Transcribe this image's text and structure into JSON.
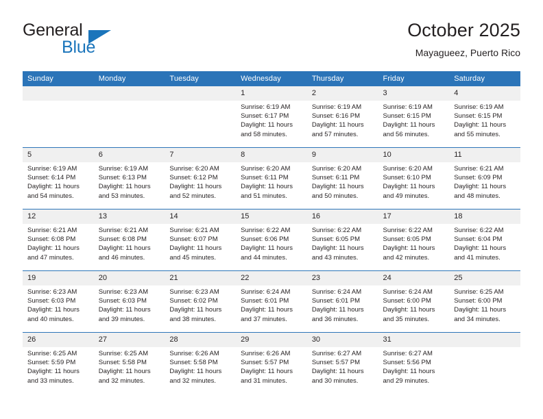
{
  "brand": {
    "name_part1": "General",
    "name_part2": "Blue",
    "triangle_color": "#1b75bb"
  },
  "header": {
    "title": "October 2025",
    "subtitle": "Mayagueez, Puerto Rico"
  },
  "theme": {
    "header_blue": "#2b74b8",
    "daynum_bg": "#f0f0f0",
    "text": "#231f20"
  },
  "weekday_headers": [
    "Sunday",
    "Monday",
    "Tuesday",
    "Wednesday",
    "Thursday",
    "Friday",
    "Saturday"
  ],
  "weeks": [
    [
      {
        "day": "",
        "empty": true,
        "sunrise": "",
        "sunset": "",
        "daylight": "",
        "daylight2": ""
      },
      {
        "day": "",
        "empty": true,
        "sunrise": "",
        "sunset": "",
        "daylight": "",
        "daylight2": ""
      },
      {
        "day": "",
        "empty": true,
        "sunrise": "",
        "sunset": "",
        "daylight": "",
        "daylight2": ""
      },
      {
        "day": "1",
        "empty": false,
        "sunrise": "Sunrise: 6:19 AM",
        "sunset": "Sunset: 6:17 PM",
        "daylight": "Daylight: 11 hours",
        "daylight2": "and 58 minutes."
      },
      {
        "day": "2",
        "empty": false,
        "sunrise": "Sunrise: 6:19 AM",
        "sunset": "Sunset: 6:16 PM",
        "daylight": "Daylight: 11 hours",
        "daylight2": "and 57 minutes."
      },
      {
        "day": "3",
        "empty": false,
        "sunrise": "Sunrise: 6:19 AM",
        "sunset": "Sunset: 6:15 PM",
        "daylight": "Daylight: 11 hours",
        "daylight2": "and 56 minutes."
      },
      {
        "day": "4",
        "empty": false,
        "sunrise": "Sunrise: 6:19 AM",
        "sunset": "Sunset: 6:15 PM",
        "daylight": "Daylight: 11 hours",
        "daylight2": "and 55 minutes."
      }
    ],
    [
      {
        "day": "5",
        "empty": false,
        "sunrise": "Sunrise: 6:19 AM",
        "sunset": "Sunset: 6:14 PM",
        "daylight": "Daylight: 11 hours",
        "daylight2": "and 54 minutes."
      },
      {
        "day": "6",
        "empty": false,
        "sunrise": "Sunrise: 6:19 AM",
        "sunset": "Sunset: 6:13 PM",
        "daylight": "Daylight: 11 hours",
        "daylight2": "and 53 minutes."
      },
      {
        "day": "7",
        "empty": false,
        "sunrise": "Sunrise: 6:20 AM",
        "sunset": "Sunset: 6:12 PM",
        "daylight": "Daylight: 11 hours",
        "daylight2": "and 52 minutes."
      },
      {
        "day": "8",
        "empty": false,
        "sunrise": "Sunrise: 6:20 AM",
        "sunset": "Sunset: 6:11 PM",
        "daylight": "Daylight: 11 hours",
        "daylight2": "and 51 minutes."
      },
      {
        "day": "9",
        "empty": false,
        "sunrise": "Sunrise: 6:20 AM",
        "sunset": "Sunset: 6:11 PM",
        "daylight": "Daylight: 11 hours",
        "daylight2": "and 50 minutes."
      },
      {
        "day": "10",
        "empty": false,
        "sunrise": "Sunrise: 6:20 AM",
        "sunset": "Sunset: 6:10 PM",
        "daylight": "Daylight: 11 hours",
        "daylight2": "and 49 minutes."
      },
      {
        "day": "11",
        "empty": false,
        "sunrise": "Sunrise: 6:21 AM",
        "sunset": "Sunset: 6:09 PM",
        "daylight": "Daylight: 11 hours",
        "daylight2": "and 48 minutes."
      }
    ],
    [
      {
        "day": "12",
        "empty": false,
        "sunrise": "Sunrise: 6:21 AM",
        "sunset": "Sunset: 6:08 PM",
        "daylight": "Daylight: 11 hours",
        "daylight2": "and 47 minutes."
      },
      {
        "day": "13",
        "empty": false,
        "sunrise": "Sunrise: 6:21 AM",
        "sunset": "Sunset: 6:08 PM",
        "daylight": "Daylight: 11 hours",
        "daylight2": "and 46 minutes."
      },
      {
        "day": "14",
        "empty": false,
        "sunrise": "Sunrise: 6:21 AM",
        "sunset": "Sunset: 6:07 PM",
        "daylight": "Daylight: 11 hours",
        "daylight2": "and 45 minutes."
      },
      {
        "day": "15",
        "empty": false,
        "sunrise": "Sunrise: 6:22 AM",
        "sunset": "Sunset: 6:06 PM",
        "daylight": "Daylight: 11 hours",
        "daylight2": "and 44 minutes."
      },
      {
        "day": "16",
        "empty": false,
        "sunrise": "Sunrise: 6:22 AM",
        "sunset": "Sunset: 6:05 PM",
        "daylight": "Daylight: 11 hours",
        "daylight2": "and 43 minutes."
      },
      {
        "day": "17",
        "empty": false,
        "sunrise": "Sunrise: 6:22 AM",
        "sunset": "Sunset: 6:05 PM",
        "daylight": "Daylight: 11 hours",
        "daylight2": "and 42 minutes."
      },
      {
        "day": "18",
        "empty": false,
        "sunrise": "Sunrise: 6:22 AM",
        "sunset": "Sunset: 6:04 PM",
        "daylight": "Daylight: 11 hours",
        "daylight2": "and 41 minutes."
      }
    ],
    [
      {
        "day": "19",
        "empty": false,
        "sunrise": "Sunrise: 6:23 AM",
        "sunset": "Sunset: 6:03 PM",
        "daylight": "Daylight: 11 hours",
        "daylight2": "and 40 minutes."
      },
      {
        "day": "20",
        "empty": false,
        "sunrise": "Sunrise: 6:23 AM",
        "sunset": "Sunset: 6:03 PM",
        "daylight": "Daylight: 11 hours",
        "daylight2": "and 39 minutes."
      },
      {
        "day": "21",
        "empty": false,
        "sunrise": "Sunrise: 6:23 AM",
        "sunset": "Sunset: 6:02 PM",
        "daylight": "Daylight: 11 hours",
        "daylight2": "and 38 minutes."
      },
      {
        "day": "22",
        "empty": false,
        "sunrise": "Sunrise: 6:24 AM",
        "sunset": "Sunset: 6:01 PM",
        "daylight": "Daylight: 11 hours",
        "daylight2": "and 37 minutes."
      },
      {
        "day": "23",
        "empty": false,
        "sunrise": "Sunrise: 6:24 AM",
        "sunset": "Sunset: 6:01 PM",
        "daylight": "Daylight: 11 hours",
        "daylight2": "and 36 minutes."
      },
      {
        "day": "24",
        "empty": false,
        "sunrise": "Sunrise: 6:24 AM",
        "sunset": "Sunset: 6:00 PM",
        "daylight": "Daylight: 11 hours",
        "daylight2": "and 35 minutes."
      },
      {
        "day": "25",
        "empty": false,
        "sunrise": "Sunrise: 6:25 AM",
        "sunset": "Sunset: 6:00 PM",
        "daylight": "Daylight: 11 hours",
        "daylight2": "and 34 minutes."
      }
    ],
    [
      {
        "day": "26",
        "empty": false,
        "sunrise": "Sunrise: 6:25 AM",
        "sunset": "Sunset: 5:59 PM",
        "daylight": "Daylight: 11 hours",
        "daylight2": "and 33 minutes."
      },
      {
        "day": "27",
        "empty": false,
        "sunrise": "Sunrise: 6:25 AM",
        "sunset": "Sunset: 5:58 PM",
        "daylight": "Daylight: 11 hours",
        "daylight2": "and 32 minutes."
      },
      {
        "day": "28",
        "empty": false,
        "sunrise": "Sunrise: 6:26 AM",
        "sunset": "Sunset: 5:58 PM",
        "daylight": "Daylight: 11 hours",
        "daylight2": "and 32 minutes."
      },
      {
        "day": "29",
        "empty": false,
        "sunrise": "Sunrise: 6:26 AM",
        "sunset": "Sunset: 5:57 PM",
        "daylight": "Daylight: 11 hours",
        "daylight2": "and 31 minutes."
      },
      {
        "day": "30",
        "empty": false,
        "sunrise": "Sunrise: 6:27 AM",
        "sunset": "Sunset: 5:57 PM",
        "daylight": "Daylight: 11 hours",
        "daylight2": "and 30 minutes."
      },
      {
        "day": "31",
        "empty": false,
        "sunrise": "Sunrise: 6:27 AM",
        "sunset": "Sunset: 5:56 PM",
        "daylight": "Daylight: 11 hours",
        "daylight2": "and 29 minutes."
      },
      {
        "day": "",
        "empty": true,
        "sunrise": "",
        "sunset": "",
        "daylight": "",
        "daylight2": ""
      }
    ]
  ]
}
